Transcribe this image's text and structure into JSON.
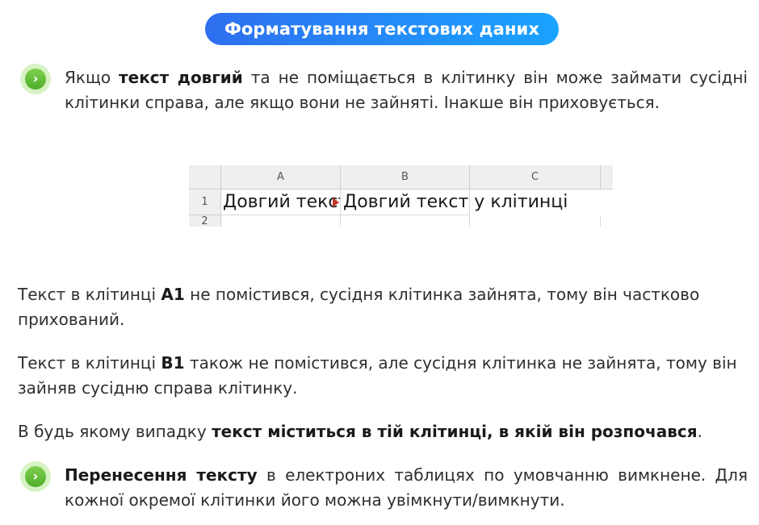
{
  "title": "Форматування текстових даних",
  "intro": {
    "before": "Якщо ",
    "bold": "текст довгий",
    "after": " та не поміщається в клітинку він може займати сусідні клітинки справа, але якщо вони не зайняті. Інакше він приховується."
  },
  "sheet": {
    "columns": [
      "A",
      "B",
      "C"
    ],
    "rows": [
      "1",
      "2"
    ],
    "a1_text": "Довгий текст",
    "b1_text": "Довгий текст у клітинці"
  },
  "p1": {
    "before": "Текст в клітинці ",
    "bold": "A1",
    "after": " не помістився, сусідня клітинка зайнята, тому він частково прихований."
  },
  "p2": {
    "before": "Текст в клітинці ",
    "bold": "B1",
    "after": " також не помістився, але сусідня клітинка не зайнята, тому він зайняв сусідню справа клітинку."
  },
  "p3": {
    "before": "В будь якому випадку ",
    "bold": "текст міститься в тій клітинці, в якій він розпочався",
    "after": "."
  },
  "wrap": {
    "bold": "Перенесення тексту",
    "after": " в електроних таблицях по умовчанню вимкнене. Для кожної окремої клітинки його можна увімкнути/вимкнути."
  },
  "icons": {
    "bullet": "chevron-right-icon"
  },
  "colors": {
    "title_bg_start": "#2f6ff0",
    "title_bg_end": "#1aa3ff",
    "bullet": "#4fae2a"
  }
}
